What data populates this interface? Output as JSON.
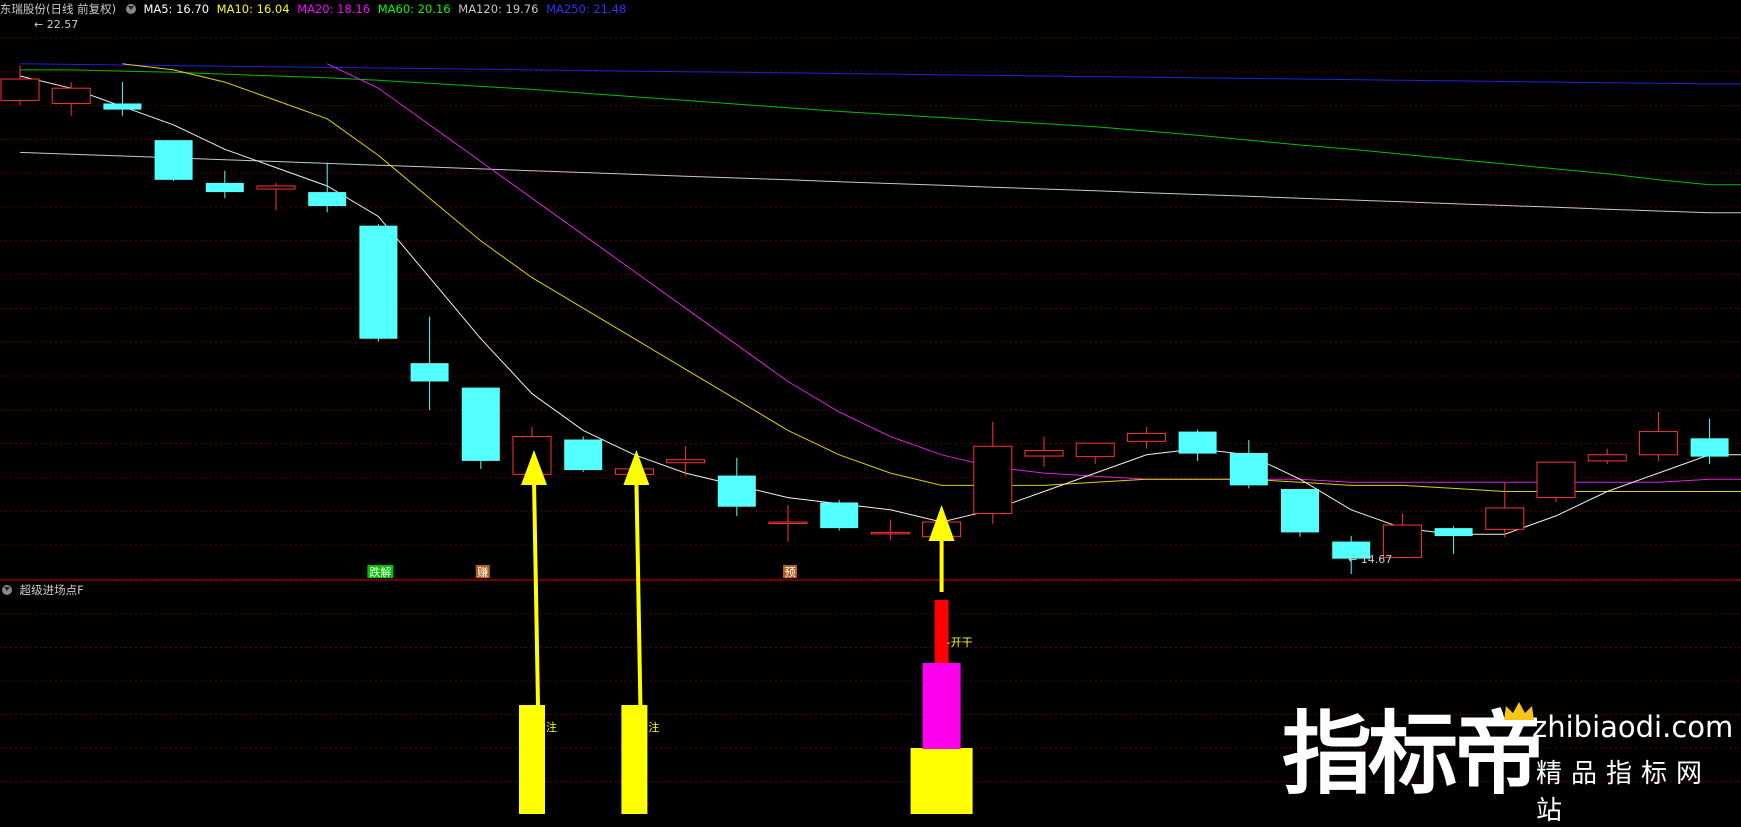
{
  "header": {
    "title": "东瑞股份(日线 前复权)",
    "ma": [
      {
        "label": "MA5: 16.70",
        "color": "#ffffff"
      },
      {
        "label": "MA10: 16.04",
        "color": "#ffff00"
      },
      {
        "label": "MA20: 18.16",
        "color": "#ff00ff"
      },
      {
        "label": "MA60: 20.16",
        "color": "#00ff00"
      },
      {
        "label": "MA120: 19.76",
        "color": "#c8c8c8"
      },
      {
        "label": "MA250: 21.48",
        "color": "#0000ff"
      }
    ]
  },
  "sub_panel": {
    "title": "超级进场点F"
  },
  "logo": {
    "cn": "指标帝",
    "url": "zhibiaodi.com",
    "sub": "精品指标网站"
  },
  "chart_data": {
    "type": "candlestick",
    "price_axis": {
      "min": 14.2,
      "max": 23.0
    },
    "annotations": {
      "high_label": "22.57",
      "low_label": "14.67"
    },
    "candles": [
      {
        "o": 22.0,
        "c": 22.35,
        "h": 22.57,
        "l": 21.92
      },
      {
        "o": 21.95,
        "c": 22.2,
        "h": 22.3,
        "l": 21.75
      },
      {
        "o": 21.95,
        "c": 21.85,
        "h": 22.3,
        "l": 21.75
      },
      {
        "o": 21.35,
        "c": 20.7,
        "h": 21.35,
        "l": 20.68
      },
      {
        "o": 20.65,
        "c": 20.5,
        "h": 20.85,
        "l": 20.4
      },
      {
        "o": 20.55,
        "c": 20.6,
        "h": 20.65,
        "l": 20.2
      },
      {
        "o": 20.5,
        "c": 20.27,
        "h": 20.98,
        "l": 20.17
      },
      {
        "o": 19.95,
        "c": 18.1,
        "h": 19.98,
        "l": 18.05
      },
      {
        "o": 17.7,
        "c": 17.4,
        "h": 18.46,
        "l": 16.93
      },
      {
        "o": 17.3,
        "c": 16.1,
        "h": 17.3,
        "l": 15.97
      },
      {
        "o": 15.88,
        "c": 16.5,
        "h": 16.66,
        "l": 15.88
      },
      {
        "o": 16.45,
        "c": 15.95,
        "h": 16.5,
        "l": 15.92
      },
      {
        "o": 15.88,
        "c": 15.97,
        "h": 16.03,
        "l": 15.83
      },
      {
        "o": 16.07,
        "c": 16.12,
        "h": 16.34,
        "l": 15.86
      },
      {
        "o": 15.86,
        "c": 15.35,
        "h": 16.15,
        "l": 15.2
      },
      {
        "o": 15.1,
        "c": 15.1,
        "h": 15.38,
        "l": 14.78
      },
      {
        "o": 15.42,
        "c": 15.0,
        "h": 15.46,
        "l": 14.96
      },
      {
        "o": 14.93,
        "c": 14.93,
        "h": 15.14,
        "l": 14.81
      },
      {
        "o": 14.86,
        "c": 15.1,
        "h": 15.27,
        "l": 14.86
      },
      {
        "o": 15.24,
        "c": 16.34,
        "h": 16.74,
        "l": 15.07
      },
      {
        "o": 16.18,
        "c": 16.27,
        "h": 16.5,
        "l": 16.0
      },
      {
        "o": 16.17,
        "c": 16.39,
        "h": 16.39,
        "l": 16.05
      },
      {
        "o": 16.42,
        "c": 16.55,
        "h": 16.66,
        "l": 16.3
      },
      {
        "o": 16.58,
        "c": 16.22,
        "h": 16.61,
        "l": 16.1
      },
      {
        "o": 16.23,
        "c": 15.7,
        "h": 16.44,
        "l": 15.65
      },
      {
        "o": 15.64,
        "c": 14.93,
        "h": 15.64,
        "l": 14.86
      },
      {
        "o": 14.78,
        "c": 14.5,
        "h": 14.87,
        "l": 14.25
      },
      {
        "o": 14.52,
        "c": 15.05,
        "h": 15.24,
        "l": 14.52
      },
      {
        "o": 15.0,
        "c": 14.87,
        "h": 15.03,
        "l": 14.58
      },
      {
        "o": 14.98,
        "c": 15.33,
        "h": 15.75,
        "l": 14.85
      },
      {
        "o": 15.5,
        "c": 16.08,
        "h": 16.08,
        "l": 15.43
      },
      {
        "o": 16.1,
        "c": 16.2,
        "h": 16.3,
        "l": 16.05
      },
      {
        "o": 16.2,
        "c": 16.58,
        "h": 16.9,
        "l": 16.1
      },
      {
        "o": 16.47,
        "c": 16.17,
        "h": 16.79,
        "l": 16.05
      }
    ],
    "ma_lines": {
      "ma5": [
        22.4,
        22.2,
        21.9,
        21.6,
        21.2,
        20.9,
        20.6,
        20.1,
        19.1,
        18.1,
        17.2,
        16.6,
        16.2,
        15.9,
        15.7,
        15.5,
        15.4,
        15.3,
        15.1,
        15.3,
        15.6,
        15.9,
        16.2,
        16.3,
        16.2,
        15.8,
        15.3,
        15.0,
        14.9,
        14.9,
        15.2,
        15.6,
        15.9,
        16.2
      ],
      "ma10": [
        null,
        null,
        22.6,
        22.5,
        22.3,
        22.0,
        21.7,
        21.1,
        20.4,
        19.7,
        19.1,
        18.6,
        18.1,
        17.6,
        17.1,
        16.6,
        16.2,
        15.9,
        15.7,
        15.7,
        15.7,
        15.75,
        15.8,
        15.8,
        15.8,
        15.75,
        15.7,
        15.7,
        15.65,
        15.6,
        15.6,
        15.6,
        15.6,
        15.6
      ],
      "ma20": [
        null,
        null,
        null,
        null,
        null,
        null,
        22.6,
        22.2,
        21.6,
        21.0,
        20.4,
        19.8,
        19.2,
        18.6,
        18.0,
        17.4,
        16.9,
        16.5,
        16.2,
        16.0,
        15.9,
        15.85,
        15.8,
        15.8,
        15.8,
        15.8,
        15.75,
        15.75,
        15.75,
        15.75,
        15.75,
        15.75,
        15.75,
        15.8
      ],
      "ma60": [
        22.5,
        22.5,
        22.48,
        22.46,
        22.43,
        22.4,
        22.37,
        22.33,
        22.28,
        22.23,
        22.18,
        22.12,
        22.06,
        22.0,
        21.94,
        21.88,
        21.82,
        21.77,
        21.72,
        21.67,
        21.62,
        21.57,
        21.5,
        21.43,
        21.35,
        21.27,
        21.2,
        21.12,
        21.04,
        20.96,
        20.88,
        20.8,
        20.7,
        20.62
      ],
      "ma120": [
        21.15,
        21.12,
        21.09,
        21.06,
        21.03,
        21.0,
        20.97,
        20.94,
        20.91,
        20.88,
        20.85,
        20.82,
        20.79,
        20.76,
        20.73,
        20.7,
        20.67,
        20.64,
        20.61,
        20.58,
        20.55,
        20.52,
        20.49,
        20.46,
        20.43,
        20.4,
        20.37,
        20.34,
        20.31,
        20.28,
        20.25,
        20.22,
        20.19,
        20.16
      ],
      "ma250": [
        22.6,
        22.59,
        22.58,
        22.57,
        22.56,
        22.55,
        22.54,
        22.53,
        22.52,
        22.51,
        22.5,
        22.49,
        22.48,
        22.47,
        22.46,
        22.45,
        22.44,
        22.43,
        22.42,
        22.41,
        22.4,
        22.39,
        22.38,
        22.37,
        22.36,
        22.35,
        22.34,
        22.33,
        22.32,
        22.31,
        22.3,
        22.29,
        22.28,
        22.27
      ]
    },
    "tags": [
      {
        "index": 7,
        "text": "跌解",
        "color": "#00c000"
      },
      {
        "index": 9,
        "text": "赚",
        "color": "#b06020"
      },
      {
        "index": 15,
        "text": "预",
        "color": "#b06020"
      }
    ],
    "signals": [
      {
        "index": 10,
        "type": "zhu",
        "label": "注"
      },
      {
        "index": 12,
        "type": "zhu",
        "label": "注"
      },
      {
        "index": 18,
        "type": "kaigan",
        "label": "开干"
      }
    ]
  }
}
